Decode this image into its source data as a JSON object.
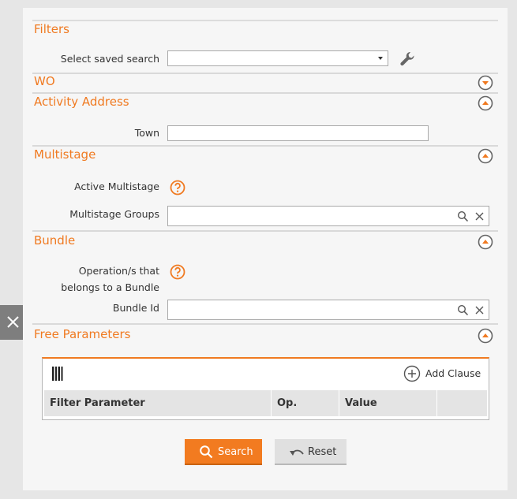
{
  "filters": {
    "title": "Filters",
    "saved_search_label": "Select saved search",
    "saved_search_value": ""
  },
  "sections": {
    "wo": "WO",
    "activity_address": "Activity Address",
    "multistage": "Multistage",
    "bundle": "Bundle",
    "free_parameters": "Free Parameters"
  },
  "activity_address": {
    "town_label": "Town",
    "town_value": ""
  },
  "multistage": {
    "active_label": "Active Multistage",
    "groups_label": "Multistage Groups",
    "groups_value": ""
  },
  "bundle": {
    "operation_label_line1": "Operation/s that",
    "operation_label_line2": "belongs to a Bundle",
    "bundle_id_label": "Bundle Id",
    "bundle_id_value": ""
  },
  "free_parameters": {
    "add_clause_label": "Add Clause",
    "columns": [
      "Filter Parameter",
      "Op.",
      "Value",
      ""
    ]
  },
  "actions": {
    "search_label": "Search",
    "reset_label": "Reset"
  },
  "colors": {
    "accent": "#f07a21",
    "panel": "#f6f6f6",
    "background": "#e6e6e6"
  },
  "icons": [
    "wrench-icon",
    "chevron-down-icon",
    "chevron-up-icon",
    "help-icon",
    "search-icon",
    "clear-icon",
    "close-icon",
    "columns-icon",
    "plus-circle-icon",
    "undo-icon"
  ]
}
